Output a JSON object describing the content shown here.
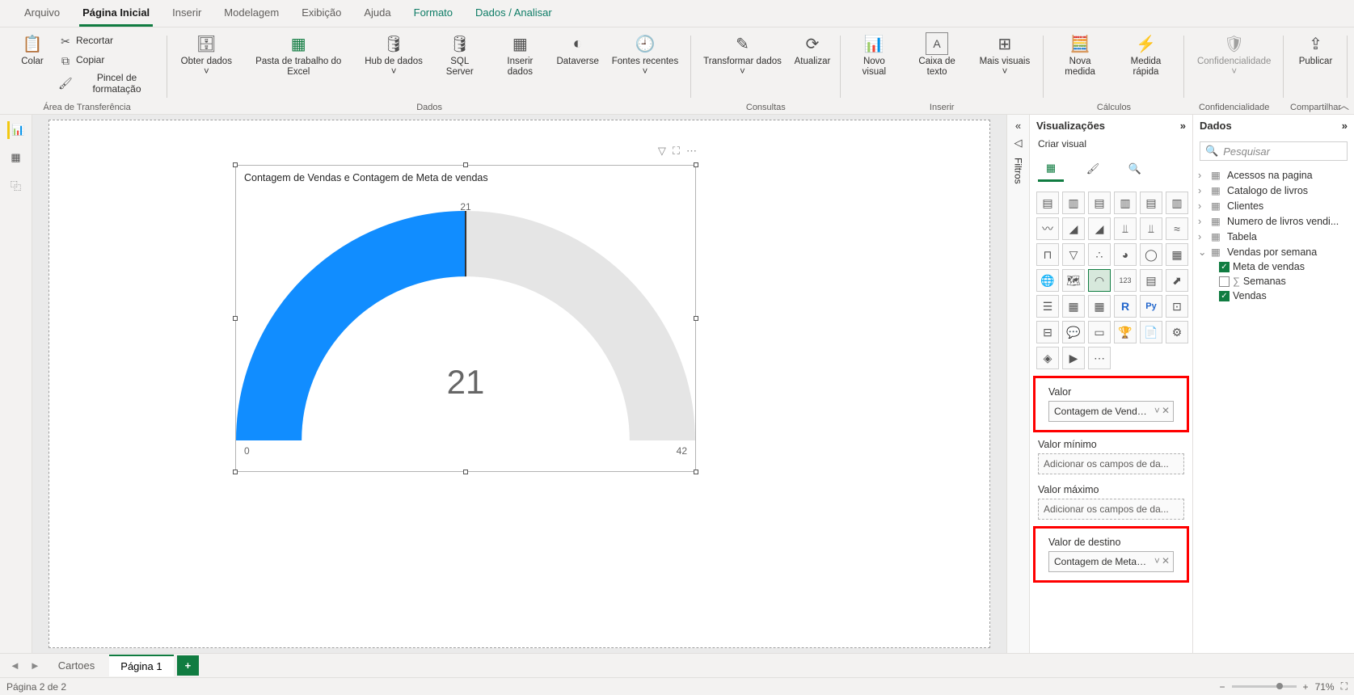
{
  "tabs": [
    "Arquivo",
    "Página Inicial",
    "Inserir",
    "Modelagem",
    "Exibição",
    "Ajuda",
    "Formato",
    "Dados / Analisar"
  ],
  "tabs_active": "Página Inicial",
  "ribbon": {
    "clipboard": {
      "paste": "Colar",
      "cut": "Recortar",
      "copy": "Copiar",
      "format_painter": "Pincel de formatação",
      "group": "Área de Transferência"
    },
    "data": {
      "get_data": "Obter dados",
      "excel": "Pasta de trabalho do Excel",
      "hub": "Hub de dados",
      "sql": "SQL Server",
      "enter": "Inserir dados",
      "dataverse": "Dataverse",
      "recent": "Fontes recentes",
      "group": "Dados"
    },
    "queries": {
      "transform": "Transformar dados",
      "refresh": "Atualizar",
      "group": "Consultas"
    },
    "insert": {
      "visual": "Novo visual",
      "textbox": "Caixa de texto",
      "more": "Mais visuais",
      "group": "Inserir"
    },
    "calc": {
      "measure": "Nova medida",
      "quick": "Medida rápida",
      "group": "Cálculos"
    },
    "sens": {
      "label": "Confidencialidade",
      "group": "Confidencialidade"
    },
    "share": {
      "publish": "Publicar",
      "group": "Compartilhar"
    }
  },
  "chart_data": {
    "type": "gauge",
    "title": "Contagem de Vendas e Contagem de Meta de vendas",
    "value": 21,
    "min": 0,
    "max": 42,
    "target": 21
  },
  "filters_label": "Filtros",
  "viz": {
    "title": "Visualizações",
    "sub": "Criar visual",
    "wells": {
      "value_label": "Valor",
      "value_field": "Contagem de Vendas",
      "min_label": "Valor mínimo",
      "min_placeholder": "Adicionar os campos de da...",
      "max_label": "Valor máximo",
      "max_placeholder": "Adicionar os campos de da...",
      "target_label": "Valor de destino",
      "target_field": "Contagem de Meta d..."
    }
  },
  "data_pane": {
    "title": "Dados",
    "search_placeholder": "Pesquisar",
    "tables": [
      "Acessos na pagina",
      "Catalogo de livros",
      "Clientes",
      "Numero de livros vendi...",
      "Tabela"
    ],
    "expanded_table": "Vendas por semana",
    "fields": [
      {
        "name": "Meta de vendas",
        "checked": true,
        "sigma": false
      },
      {
        "name": "Semanas",
        "checked": false,
        "sigma": true
      },
      {
        "name": "Vendas",
        "checked": true,
        "sigma": false
      }
    ]
  },
  "page_tabs": {
    "tabs": [
      "Cartoes",
      "Página 1"
    ],
    "active": "Página 1",
    "add": "+"
  },
  "status": {
    "left": "Página 2 de 2",
    "zoom": "71%"
  }
}
